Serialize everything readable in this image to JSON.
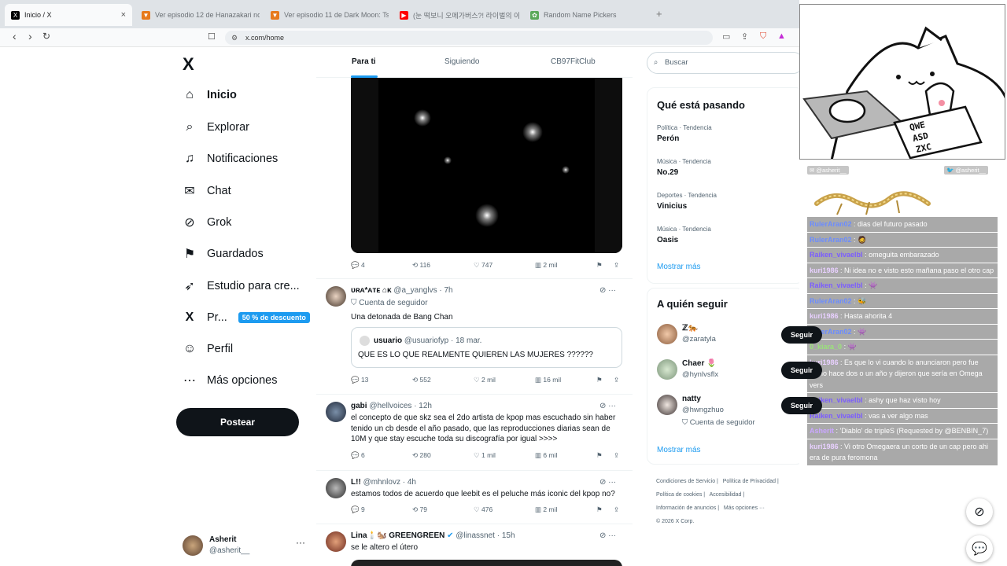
{
  "browser": {
    "tabs": [
      {
        "title": "Inicio / X",
        "favicon": "x-icon",
        "active": true
      },
      {
        "title": "Ver episodio 12 de Hanazakari no Ki",
        "favicon": "anime-site-icon"
      },
      {
        "title": "Ver episodio 11 de Dark Moon: Tsuk",
        "favicon": "anime-site-icon"
      },
      {
        "title": "(눈 떡보니 오메가버스?! 라이벌의 아",
        "favicon": "youtube-icon"
      },
      {
        "title": "Random Name Pickers",
        "favicon": "picker-icon"
      }
    ],
    "close_glyph": "×",
    "new_tab_glyph": "+",
    "url": "x.com/home",
    "icons": {
      "back": "‹",
      "forward": "›",
      "reload": "↻",
      "bookmark": "☐",
      "lock": "⚙"
    }
  },
  "sidebar": {
    "logo": "X",
    "items": [
      {
        "label": "Inicio",
        "icon": "home-icon",
        "glyph": "⌂"
      },
      {
        "label": "Explorar",
        "icon": "search-icon",
        "glyph": "⌕"
      },
      {
        "label": "Notificaciones",
        "icon": "bell-icon",
        "glyph": "♫"
      },
      {
        "label": "Chat",
        "icon": "mail-icon",
        "glyph": "✉"
      },
      {
        "label": "Grok",
        "icon": "grok-icon",
        "glyph": "⊘"
      },
      {
        "label": "Guardados",
        "icon": "bookmark-icon",
        "glyph": "⚑"
      },
      {
        "label": "Estudio para cre...",
        "icon": "rocket-icon",
        "glyph": "➶"
      },
      {
        "label": "Pr...",
        "icon": "x-premium-icon",
        "glyph": "X"
      },
      {
        "label": "Perfil",
        "icon": "user-icon",
        "glyph": "☺"
      },
      {
        "label": "Más opciones",
        "icon": "more-circle-icon",
        "glyph": "⋯"
      }
    ],
    "promo_badge": "50 % de descuento",
    "post_button": "Postear",
    "account": {
      "name": "Asherit",
      "handle": "@asherit__",
      "more": "···"
    }
  },
  "feed": {
    "tabs": [
      "Para ti",
      "Siguiendo",
      "CB97FitClub"
    ],
    "first_post_stats": {
      "replies": "4",
      "reposts": "116",
      "likes": "747",
      "views": "2 mil"
    },
    "posts": [
      {
        "name": "ᴜʀᴀ*ᴀᴛᴇ ⌂ᴋ",
        "handle": "@a_yanglvs",
        "time": "· 7h",
        "follower_tag": "Cuenta de seguidor",
        "text": "Una detonada de Bang Chan",
        "quote": {
          "name": "usuario",
          "handle": "@usuariofyp",
          "date": "· 18 mar.",
          "text": "QUE ES LO QUE REALMENTE QUIEREN LAS MUJERES ??????"
        },
        "stats": {
          "replies": "13",
          "reposts": "552",
          "likes": "2 mil",
          "views": "16 mil"
        }
      },
      {
        "name": "gabi",
        "handle": "@hellvoices",
        "time": "· 12h",
        "text": "el concepto de que skz sea el 2do artista de kpop mas escuchado sin haber tenido un cb desde el año pasado, que las reproducciones diarias sean de 10M y que stay escuche toda su discografía por igual >>>>",
        "stats": {
          "replies": "6",
          "reposts": "280",
          "likes": "1 mil",
          "views": "6 mil"
        }
      },
      {
        "name": "L!!",
        "handle": "@mhnlovz",
        "time": "· 4h",
        "text": "estamos todos de acuerdo que leebit es el peluche más iconic del kpop no?",
        "stats": {
          "replies": "9",
          "reposts": "79",
          "likes": "476",
          "views": "2 mil"
        }
      },
      {
        "name": "Lina🕯️🐿️ GREENGREEN",
        "handle": "@linassnet",
        "time": "· 15h",
        "text": "se le altero el útero"
      }
    ]
  },
  "right": {
    "search_placeholder": "Buscar",
    "trends_title": "Qué está pasando",
    "trends": [
      {
        "category": "Política · Tendencia",
        "name": "Perón"
      },
      {
        "category": "Música · Tendencia",
        "name": "No.29"
      },
      {
        "category": "Deportes · Tendencia",
        "name": "Vinicius"
      },
      {
        "category": "Música · Tendencia",
        "name": "Oasis"
      }
    ],
    "show_more": "Mostrar más",
    "follow_title": "A quién seguir",
    "follow": [
      {
        "name": "ℤ🐅",
        "handle": "@zaratyla"
      },
      {
        "name": "Chaer 🌷",
        "handle": "@hynlvsflx"
      },
      {
        "name": "natty",
        "handle": "@hwngzhuo",
        "tag": "Cuenta de seguidor"
      }
    ],
    "follow_button": "Seguir",
    "footer": [
      "Condiciones de Servicio |",
      "Política de Privacidad |",
      "Política de cookies |",
      "Accesibilidad |",
      "Información de anuncios |",
      "Más opciones ···",
      "© 2026 X Corp."
    ]
  },
  "stream_overlay": {
    "chat_header_left": "@asherit__",
    "chat_header_right": "@asherit__",
    "chat": [
      {
        "user": "RulerAran02",
        "text": ": dias del futuro pasado"
      },
      {
        "user": "RulerAran02",
        "text": ": 🧔"
      },
      {
        "user": "Raiken_vivaelbl",
        "text": ": omeguita embarazado"
      },
      {
        "user": "kuri1986",
        "text": ": Ni idea no e visto esto mañana paso el otro cap"
      },
      {
        "user": "Raiken_vivaelbl",
        "text": ": 👾"
      },
      {
        "user": "RulerAran02",
        "text": ": 🐝"
      },
      {
        "user": "kuri1986",
        "text": ": Hasta ahorita 4"
      },
      {
        "user": "RulerAran02",
        "text": ": 👾"
      },
      {
        "user": "0_kiara_0",
        "text": ": 👾"
      },
      {
        "user": "kuri1986",
        "text": ": Es que lo vi cuando lo anunciaron pero fue como hace dos o un año y dijeron que sería en Omega vers"
      },
      {
        "user": "Raiken_vivaelbl",
        "text": ": ashy que haz visto hoy"
      },
      {
        "user": "Raiken_vivaelbl",
        "text": ": vas a ver algo mas"
      },
      {
        "user": "Asherit",
        "text": ": 'Diablo' de tripleS (Requested by @BENBIN_7)"
      },
      {
        "user": "kuri1986",
        "text": ": Vi otro Omegaera un corto de un cap pero ahi era de pura feromona"
      }
    ],
    "keyboard_keys": [
      "QWE",
      "ASD",
      "ZXC"
    ]
  }
}
